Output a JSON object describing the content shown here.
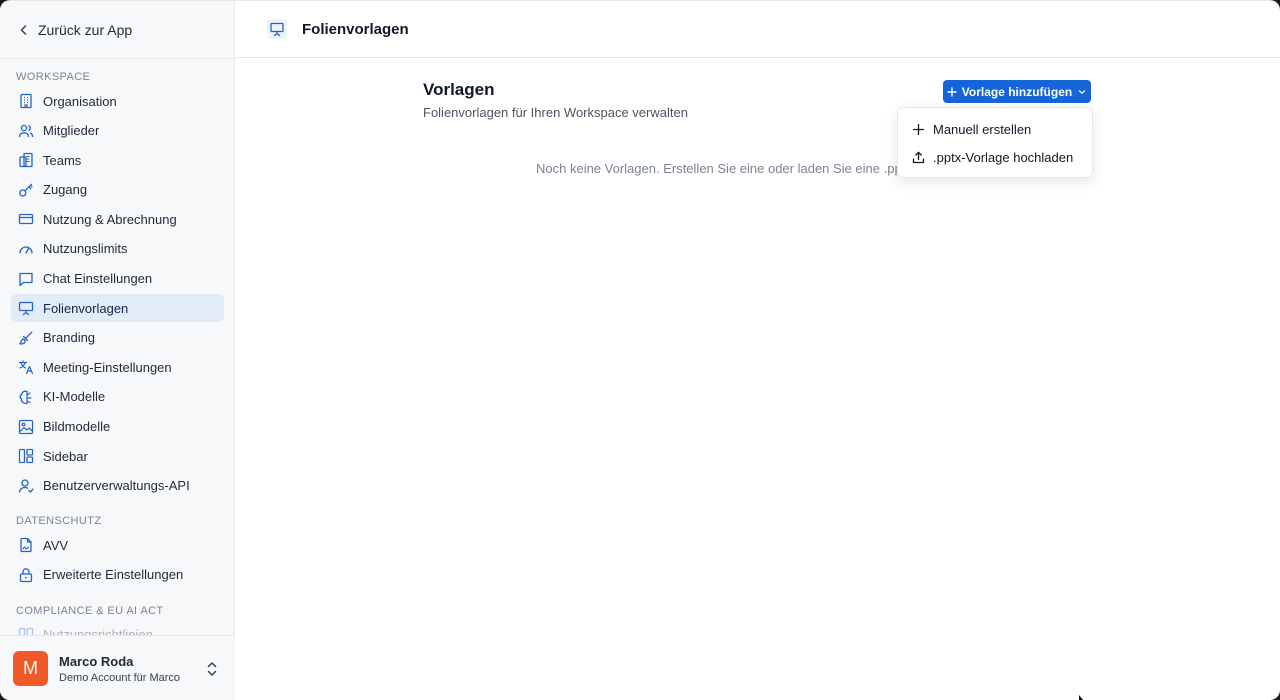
{
  "sidebar": {
    "back_label": "Zurück zur App",
    "sections": [
      {
        "title": "WORKSPACE",
        "items": [
          {
            "label": "Organisation",
            "icon": "building-icon"
          },
          {
            "label": "Mitglieder",
            "icon": "users-icon"
          },
          {
            "label": "Teams",
            "icon": "teams-icon"
          },
          {
            "label": "Zugang",
            "icon": "key-icon"
          },
          {
            "label": "Nutzung & Abrechnung",
            "icon": "credit-card-icon"
          },
          {
            "label": "Nutzungslimits",
            "icon": "gauge-icon"
          },
          {
            "label": "Chat Einstellungen",
            "icon": "chat-icon"
          },
          {
            "label": "Folienvorlagen",
            "icon": "presentation-icon",
            "active": true
          },
          {
            "label": "Branding",
            "icon": "brush-icon"
          },
          {
            "label": "Meeting-Einstellungen",
            "icon": "translate-icon"
          },
          {
            "label": "KI-Modelle",
            "icon": "brain-icon"
          },
          {
            "label": "Bildmodelle",
            "icon": "image-icon"
          },
          {
            "label": "Sidebar",
            "icon": "layout-icon"
          },
          {
            "label": "Benutzerverwaltungs-API",
            "icon": "user-api-icon"
          }
        ]
      },
      {
        "title": "DATENSCHUTZ",
        "items": [
          {
            "label": "AVV",
            "icon": "document-signature-icon"
          },
          {
            "label": "Erweiterte Einstellungen",
            "icon": "lock-icon"
          }
        ]
      },
      {
        "title": "COMPLIANCE & EU AI ACT",
        "items": [
          {
            "label": "Nutzungsrichtlinien",
            "icon": "layout-icon"
          }
        ]
      }
    ],
    "user": {
      "initial": "M",
      "name": "Marco Roda",
      "account": "Demo Account für Marco",
      "avatar_color": "#f05a28"
    }
  },
  "header": {
    "title": "Folienvorlagen",
    "icon": "presentation-icon"
  },
  "main": {
    "title": "Vorlagen",
    "subtitle": "Folienvorlagen für Ihren Workspace verwalten",
    "add_button_label": "Vorlage hinzufügen",
    "empty_text": "Noch keine Vorlagen. Erstellen Sie eine oder laden Sie eine .pp",
    "dropdown": [
      {
        "label": "Manuell erstellen",
        "icon": "plus-icon"
      },
      {
        "label": ".pptx-Vorlage hochladen",
        "icon": "upload-icon"
      }
    ]
  },
  "colors": {
    "accent": "#1565d8",
    "active_bg": "#e2ecf8",
    "icon_blue": "#2563c9"
  }
}
